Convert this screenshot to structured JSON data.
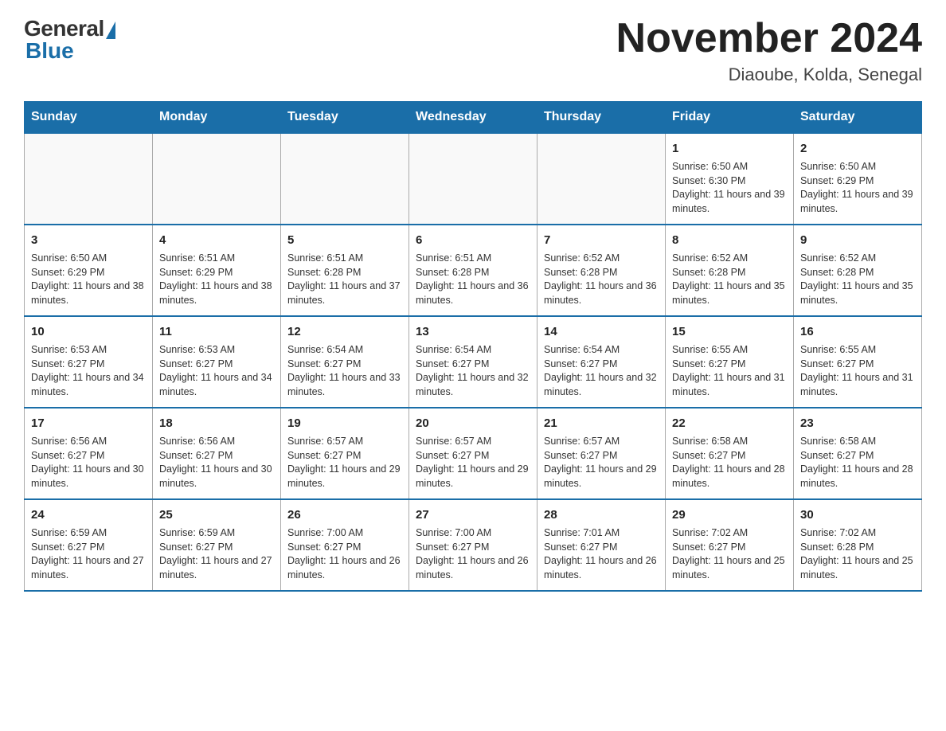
{
  "header": {
    "logo": {
      "general_text": "General",
      "blue_text": "Blue"
    },
    "title": "November 2024",
    "location": "Diaoube, Kolda, Senegal"
  },
  "weekdays": [
    "Sunday",
    "Monday",
    "Tuesday",
    "Wednesday",
    "Thursday",
    "Friday",
    "Saturday"
  ],
  "weeks": [
    [
      {
        "day": "",
        "info": ""
      },
      {
        "day": "",
        "info": ""
      },
      {
        "day": "",
        "info": ""
      },
      {
        "day": "",
        "info": ""
      },
      {
        "day": "",
        "info": ""
      },
      {
        "day": "1",
        "info": "Sunrise: 6:50 AM\nSunset: 6:30 PM\nDaylight: 11 hours and 39 minutes."
      },
      {
        "day": "2",
        "info": "Sunrise: 6:50 AM\nSunset: 6:29 PM\nDaylight: 11 hours and 39 minutes."
      }
    ],
    [
      {
        "day": "3",
        "info": "Sunrise: 6:50 AM\nSunset: 6:29 PM\nDaylight: 11 hours and 38 minutes."
      },
      {
        "day": "4",
        "info": "Sunrise: 6:51 AM\nSunset: 6:29 PM\nDaylight: 11 hours and 38 minutes."
      },
      {
        "day": "5",
        "info": "Sunrise: 6:51 AM\nSunset: 6:28 PM\nDaylight: 11 hours and 37 minutes."
      },
      {
        "day": "6",
        "info": "Sunrise: 6:51 AM\nSunset: 6:28 PM\nDaylight: 11 hours and 36 minutes."
      },
      {
        "day": "7",
        "info": "Sunrise: 6:52 AM\nSunset: 6:28 PM\nDaylight: 11 hours and 36 minutes."
      },
      {
        "day": "8",
        "info": "Sunrise: 6:52 AM\nSunset: 6:28 PM\nDaylight: 11 hours and 35 minutes."
      },
      {
        "day": "9",
        "info": "Sunrise: 6:52 AM\nSunset: 6:28 PM\nDaylight: 11 hours and 35 minutes."
      }
    ],
    [
      {
        "day": "10",
        "info": "Sunrise: 6:53 AM\nSunset: 6:27 PM\nDaylight: 11 hours and 34 minutes."
      },
      {
        "day": "11",
        "info": "Sunrise: 6:53 AM\nSunset: 6:27 PM\nDaylight: 11 hours and 34 minutes."
      },
      {
        "day": "12",
        "info": "Sunrise: 6:54 AM\nSunset: 6:27 PM\nDaylight: 11 hours and 33 minutes."
      },
      {
        "day": "13",
        "info": "Sunrise: 6:54 AM\nSunset: 6:27 PM\nDaylight: 11 hours and 32 minutes."
      },
      {
        "day": "14",
        "info": "Sunrise: 6:54 AM\nSunset: 6:27 PM\nDaylight: 11 hours and 32 minutes."
      },
      {
        "day": "15",
        "info": "Sunrise: 6:55 AM\nSunset: 6:27 PM\nDaylight: 11 hours and 31 minutes."
      },
      {
        "day": "16",
        "info": "Sunrise: 6:55 AM\nSunset: 6:27 PM\nDaylight: 11 hours and 31 minutes."
      }
    ],
    [
      {
        "day": "17",
        "info": "Sunrise: 6:56 AM\nSunset: 6:27 PM\nDaylight: 11 hours and 30 minutes."
      },
      {
        "day": "18",
        "info": "Sunrise: 6:56 AM\nSunset: 6:27 PM\nDaylight: 11 hours and 30 minutes."
      },
      {
        "day": "19",
        "info": "Sunrise: 6:57 AM\nSunset: 6:27 PM\nDaylight: 11 hours and 29 minutes."
      },
      {
        "day": "20",
        "info": "Sunrise: 6:57 AM\nSunset: 6:27 PM\nDaylight: 11 hours and 29 minutes."
      },
      {
        "day": "21",
        "info": "Sunrise: 6:57 AM\nSunset: 6:27 PM\nDaylight: 11 hours and 29 minutes."
      },
      {
        "day": "22",
        "info": "Sunrise: 6:58 AM\nSunset: 6:27 PM\nDaylight: 11 hours and 28 minutes."
      },
      {
        "day": "23",
        "info": "Sunrise: 6:58 AM\nSunset: 6:27 PM\nDaylight: 11 hours and 28 minutes."
      }
    ],
    [
      {
        "day": "24",
        "info": "Sunrise: 6:59 AM\nSunset: 6:27 PM\nDaylight: 11 hours and 27 minutes."
      },
      {
        "day": "25",
        "info": "Sunrise: 6:59 AM\nSunset: 6:27 PM\nDaylight: 11 hours and 27 minutes."
      },
      {
        "day": "26",
        "info": "Sunrise: 7:00 AM\nSunset: 6:27 PM\nDaylight: 11 hours and 26 minutes."
      },
      {
        "day": "27",
        "info": "Sunrise: 7:00 AM\nSunset: 6:27 PM\nDaylight: 11 hours and 26 minutes."
      },
      {
        "day": "28",
        "info": "Sunrise: 7:01 AM\nSunset: 6:27 PM\nDaylight: 11 hours and 26 minutes."
      },
      {
        "day": "29",
        "info": "Sunrise: 7:02 AM\nSunset: 6:27 PM\nDaylight: 11 hours and 25 minutes."
      },
      {
        "day": "30",
        "info": "Sunrise: 7:02 AM\nSunset: 6:28 PM\nDaylight: 11 hours and 25 minutes."
      }
    ]
  ]
}
